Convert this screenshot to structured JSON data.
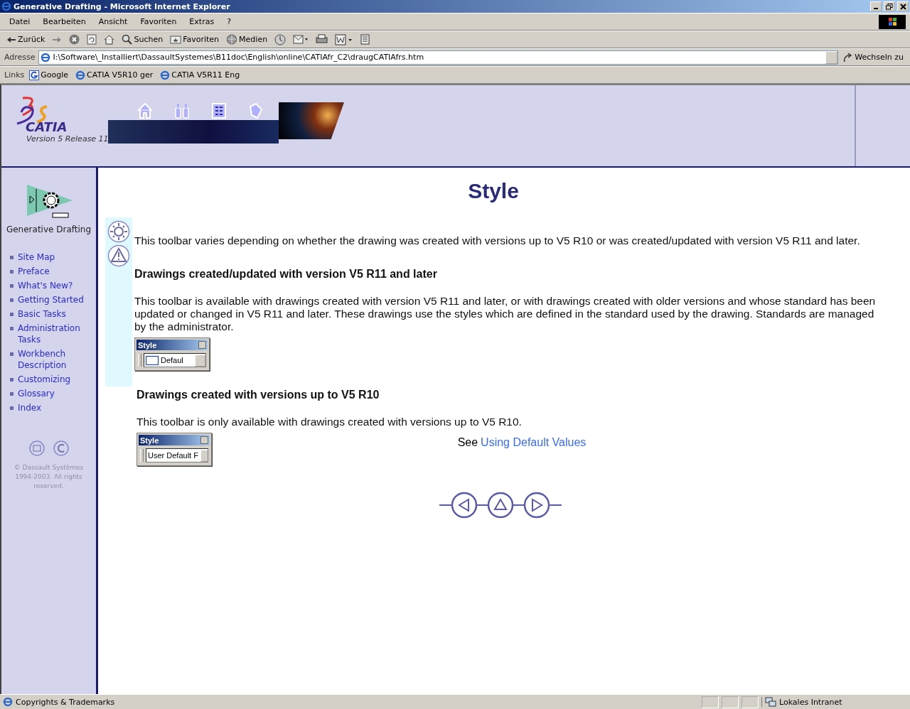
{
  "window": {
    "title": "Generative Drafting - Microsoft Internet Explorer"
  },
  "menu": [
    "Datei",
    "Bearbeiten",
    "Ansicht",
    "Favoriten",
    "Extras",
    "?"
  ],
  "toolbar": [
    {
      "kind": "back",
      "label": "Zurück"
    },
    {
      "kind": "forward"
    },
    {
      "kind": "stop"
    },
    {
      "kind": "refresh"
    },
    {
      "kind": "home"
    },
    {
      "kind": "search",
      "label": "Suchen"
    },
    {
      "kind": "favorites",
      "label": "Favoriten"
    },
    {
      "kind": "media",
      "label": "Medien"
    },
    {
      "kind": "history"
    },
    {
      "kind": "mail"
    },
    {
      "kind": "print"
    },
    {
      "kind": "edit"
    },
    {
      "kind": "discuss"
    }
  ],
  "address": {
    "label": "Adresse",
    "value": "I:\\Software\\_Installiert\\DassaultSystemes\\B11doc\\English\\online\\CATIAfr_C2\\draugCATIAfrs.htm",
    "go": "Wechseln zu"
  },
  "links": {
    "label": "Links",
    "items": [
      {
        "kind": "google",
        "label": "Google"
      },
      {
        "kind": "ie",
        "label": "CATIA V5R10 ger"
      },
      {
        "kind": "ie",
        "label": "CATIA V5R11 Eng"
      }
    ]
  },
  "header": {
    "brand": "CATIA",
    "version": "Version 5 Release 11"
  },
  "sidebar": {
    "product": "Generative Drafting",
    "nav": [
      "Site Map",
      "Preface",
      "What's New?",
      "Getting Started",
      "Basic Tasks",
      "Administration Tasks",
      "Workbench Description",
      "Customizing",
      "Glossary",
      "Index"
    ],
    "copyright": "© Dassault Systèmes 1994-2003. All rights reserved."
  },
  "content": {
    "title": "Style",
    "intro": "This toolbar varies depending on whether the drawing was created with versions up to V5 R10 or was created/updated with version V5 R11 and later.",
    "sections": [
      {
        "heading": "Drawings created/updated with version V5 R11 and later",
        "body": "This toolbar is available with drawings created with version V5 R11 and later, or with drawings created with older versions and whose standard has been updated or changed in V5 R11 and later. These drawings use the styles which are defined in the standard used by the drawing. Standards are managed by the administrator.",
        "toolbar": {
          "title": "Style",
          "value": "Defaul",
          "swatch": true
        }
      },
      {
        "heading": "Drawings created with versions up to V5 R10",
        "body": "This toolbar is only available with drawings created with versions up to V5 R10.",
        "toolbar": {
          "title": "Style",
          "value": "User Default F",
          "swatch": false
        }
      }
    ],
    "see": {
      "text": "See",
      "link": "Using Default Values"
    }
  },
  "status": {
    "text": "Copyrights & Trademarks",
    "zone": "Lokales Intranet"
  }
}
